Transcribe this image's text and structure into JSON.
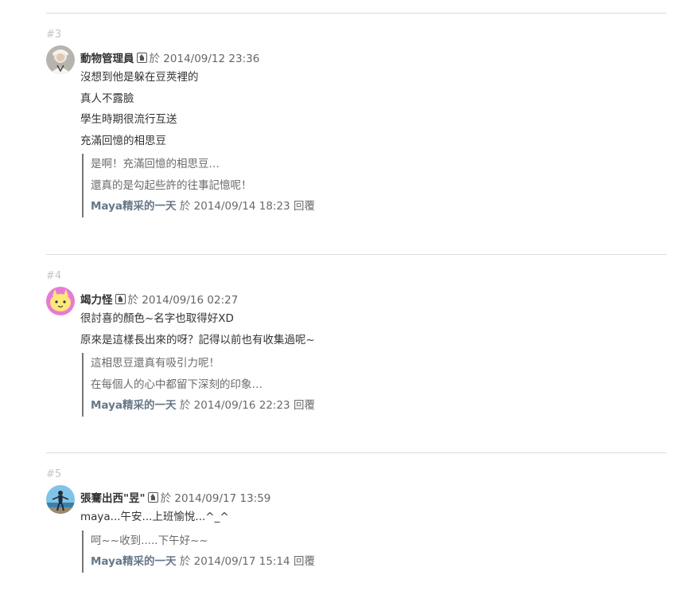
{
  "comments": [
    {
      "number": "#3",
      "author": "動物管理員",
      "at": "於",
      "time": "2014/09/12 23:36",
      "lines": [
        "沒想到他是躲在豆莢裡的",
        "真人不露臉",
        "學生時期很流行互送",
        "充滿回憶的相思豆"
      ],
      "reply": {
        "lines": [
          "是啊！充滿回憶的相思豆…",
          "還真的是勾起些許的往事記憶呢！"
        ],
        "author": "Maya精采的一天",
        "at": "於",
        "time": "2014/09/14 18:23",
        "reply_word": "回覆"
      }
    },
    {
      "number": "#4",
      "author": "竭力怪",
      "at": "於",
      "time": "2014/09/16 02:27",
      "lines": [
        "很討喜的顏色~名字也取得好XD",
        "原來是這樣長出來的呀？記得以前也有收集過呢~"
      ],
      "reply": {
        "lines": [
          "這相思豆還真有吸引力呢！",
          "在每個人的心中都留下深刻的印象…"
        ],
        "author": "Maya精采的一天",
        "at": "於",
        "time": "2014/09/16 22:23",
        "reply_word": "回覆"
      }
    },
    {
      "number": "#5",
      "author": "張騫出西\"昱\"",
      "at": "於",
      "time": "2014/09/17 13:59",
      "lines": [
        "maya...午安...上班愉悅...^_^"
      ],
      "reply": {
        "lines": [
          "呵~~收到.....下午好~~"
        ],
        "author": "Maya精采的一天",
        "at": "於",
        "time": "2014/09/17 15:14",
        "reply_word": "回覆"
      }
    }
  ],
  "icons": {
    "avatar": "avatar-icon",
    "blog": "blog-home-icon"
  },
  "colors": {
    "divider": "#dcdcdc",
    "reply_author": "#667788",
    "reply_border": "#777777",
    "number": "#c4c4c4"
  }
}
